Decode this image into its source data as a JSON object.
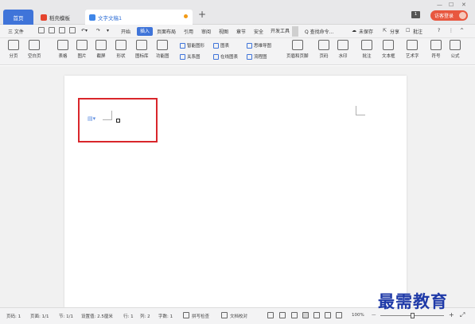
{
  "tabs": [
    {
      "label": "首页"
    },
    {
      "label": "稻壳模板"
    },
    {
      "label": "文字文稿1"
    }
  ],
  "titlebar": {
    "new_tab": "+",
    "badge": "1",
    "login_label": "访客登录",
    "minimize": "—",
    "restore": "☐",
    "close": "✕"
  },
  "menu": {
    "file": "三 文件",
    "items": [
      "开始",
      "插入",
      "页面布局",
      "引用",
      "审阅",
      "视图",
      "章节",
      "安全",
      "开发工具"
    ],
    "active": "插入",
    "search": "Q 查找命令...",
    "unsaved": "未保存",
    "share": "分享",
    "comment": "批注",
    "help": "?",
    "more": "⋮",
    "collapse": "^"
  },
  "tools": {
    "page_break": "分页",
    "blank_page": "空白页",
    "table": "表格",
    "picture": "图片",
    "screenshot": "截屏",
    "shape": "形状",
    "icon_lib": "图标库",
    "function_chart": "功能图",
    "smart_graphic": "智能图形",
    "chart": "图表",
    "mind_map": "思维导图",
    "relation": "关系图",
    "online_chart": "在线图表",
    "flowchart": "流程图",
    "header_footer": "页眉和页脚",
    "page_number": "页码",
    "watermark": "水印",
    "comment": "批注",
    "textbox": "文本框",
    "wordart": "艺术字",
    "symbol": "符号",
    "formula": "公式"
  },
  "document": {
    "para_icon": "▤▾"
  },
  "status": {
    "page": "页码: 1",
    "pages": "页面: 1/1",
    "section": "节: 1/1",
    "position": "设置值: 2.5厘米",
    "row": "行: 1",
    "col": "列: 2",
    "words": "字数: 1",
    "spell": "拼写检查",
    "proofread": "文档校对",
    "zoom": "100%",
    "zoom_minus": "—",
    "zoom_plus": "+"
  },
  "watermark_text": "最需教育"
}
